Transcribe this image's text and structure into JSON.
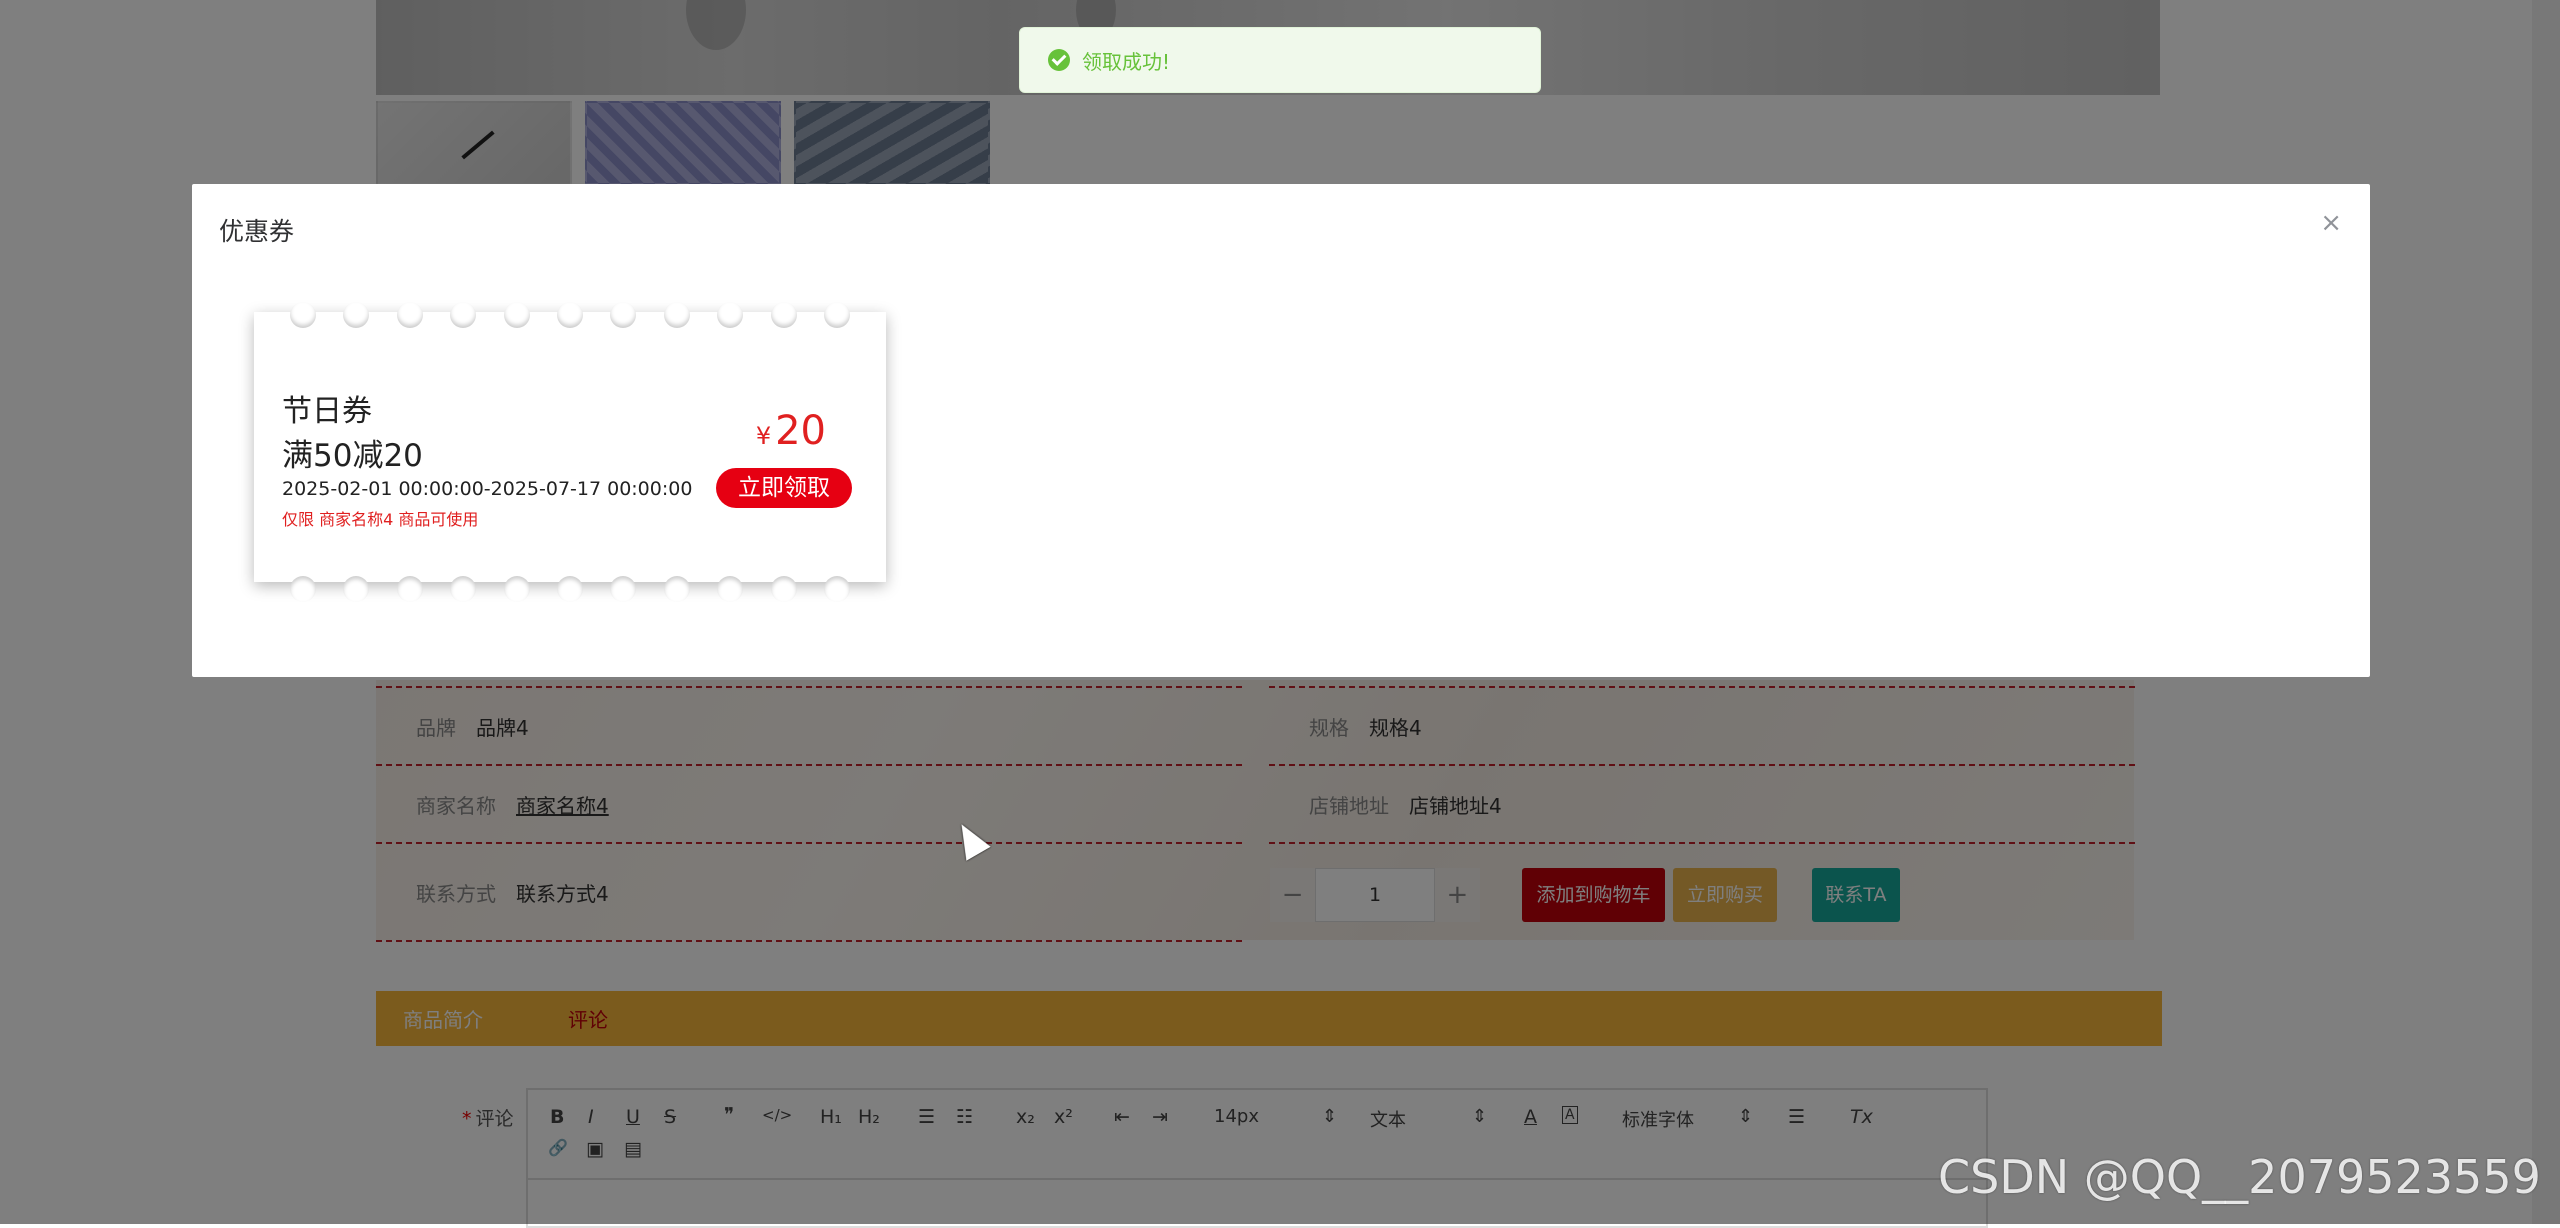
{
  "toast": {
    "message": "领取成功!"
  },
  "dialog": {
    "title": "优惠券",
    "close_glyph": "×",
    "coupon": {
      "name": "节日券",
      "rule": "满50减20",
      "validity": "2025-02-01 00:00:00-2025-07-17 00:00:00",
      "scope": "仅限 商家名称4 商品可使用",
      "currency": "¥",
      "amount": "20",
      "claim_label": "立即领取"
    }
  },
  "details": {
    "brand_label": "品牌",
    "brand_value": "品牌4",
    "spec_label": "规格",
    "spec_value": "规格4",
    "merchant_label": "商家名称",
    "merchant_value": "商家名称4",
    "address_label": "店铺地址",
    "address_value": "店铺地址4",
    "contact_label": "联系方式",
    "contact_value": "联系方式4"
  },
  "purchase": {
    "minus": "−",
    "quantity": "1",
    "plus": "+",
    "add_to_cart": "添加到购物车",
    "buy_now": "立即购买",
    "contact_seller": "联系TA"
  },
  "tabs": [
    {
      "label": "商品简介"
    },
    {
      "label": "评论"
    }
  ],
  "comment": {
    "required_mark": "*",
    "label": "评论",
    "toolbar": {
      "bold": "B",
      "italic": "I",
      "underline": "U",
      "strike": "S",
      "quote": "❞",
      "code": "</>",
      "h1": "H₁",
      "h2": "H₂",
      "ordered_list": "☰",
      "bullet_list": "☷",
      "subscript": "x₂",
      "superscript": "x²",
      "outdent": "⇤",
      "indent": "⇥",
      "size": "14px",
      "header": "文本",
      "font": "标准字体",
      "color": "A",
      "background": "A",
      "align": "☰",
      "clean": "Tx",
      "link": "🔗",
      "image": "▣",
      "video": "▤"
    }
  },
  "watermark": "CSDN @QQ__2079523559"
}
